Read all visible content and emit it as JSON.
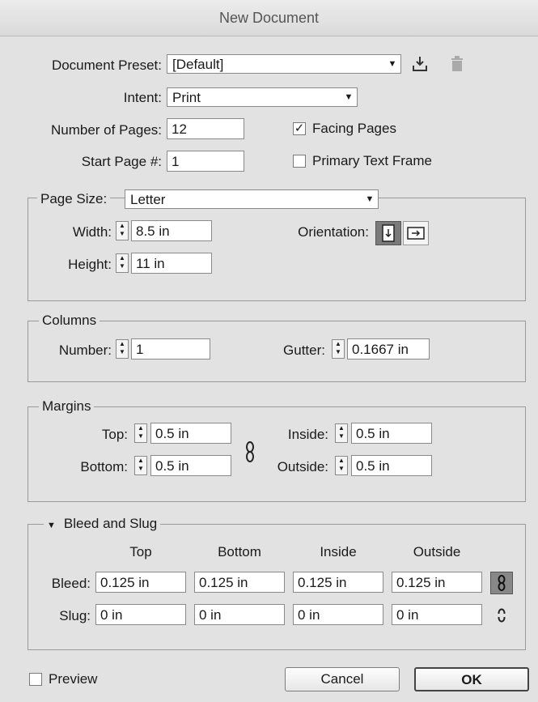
{
  "window": {
    "title": "New Document"
  },
  "preset": {
    "label": "Document Preset:",
    "value": "[Default]",
    "save_icon": "save-preset-icon",
    "delete_icon": "trash-icon"
  },
  "intent": {
    "label": "Intent:",
    "value": "Print"
  },
  "pages": {
    "label": "Number of Pages:",
    "value": "12"
  },
  "start_page": {
    "label": "Start Page #:",
    "value": "1"
  },
  "facing_pages": {
    "label": "Facing Pages",
    "checked": true
  },
  "primary_text_frame": {
    "label": "Primary Text Frame",
    "checked": false
  },
  "page_size": {
    "label": "Page Size:",
    "value": "Letter",
    "width_label": "Width:",
    "width": "8.5 in",
    "height_label": "Height:",
    "height": "11 in",
    "orientation_label": "Orientation:",
    "orientation_selected": "portrait"
  },
  "columns": {
    "legend": "Columns",
    "number_label": "Number:",
    "number": "1",
    "gutter_label": "Gutter:",
    "gutter": "0.1667 in"
  },
  "margins": {
    "legend": "Margins",
    "top_label": "Top:",
    "top": "0.5 in",
    "bottom_label": "Bottom:",
    "bottom": "0.5 in",
    "inside_label": "Inside:",
    "inside": "0.5 in",
    "outside_label": "Outside:",
    "outside": "0.5 in",
    "link_icon": "chain-link-icon"
  },
  "bleed_slug": {
    "legend": "Bleed and Slug",
    "headers": [
      "Top",
      "Bottom",
      "Inside",
      "Outside"
    ],
    "bleed_label": "Bleed:",
    "bleed": [
      "0.125 in",
      "0.125 in",
      "0.125 in",
      "0.125 in"
    ],
    "slug_label": "Slug:",
    "slug": [
      "0 in",
      "0 in",
      "0 in",
      "0 in"
    ]
  },
  "preview": {
    "label": "Preview",
    "checked": false
  },
  "buttons": {
    "cancel": "Cancel",
    "ok": "OK"
  }
}
